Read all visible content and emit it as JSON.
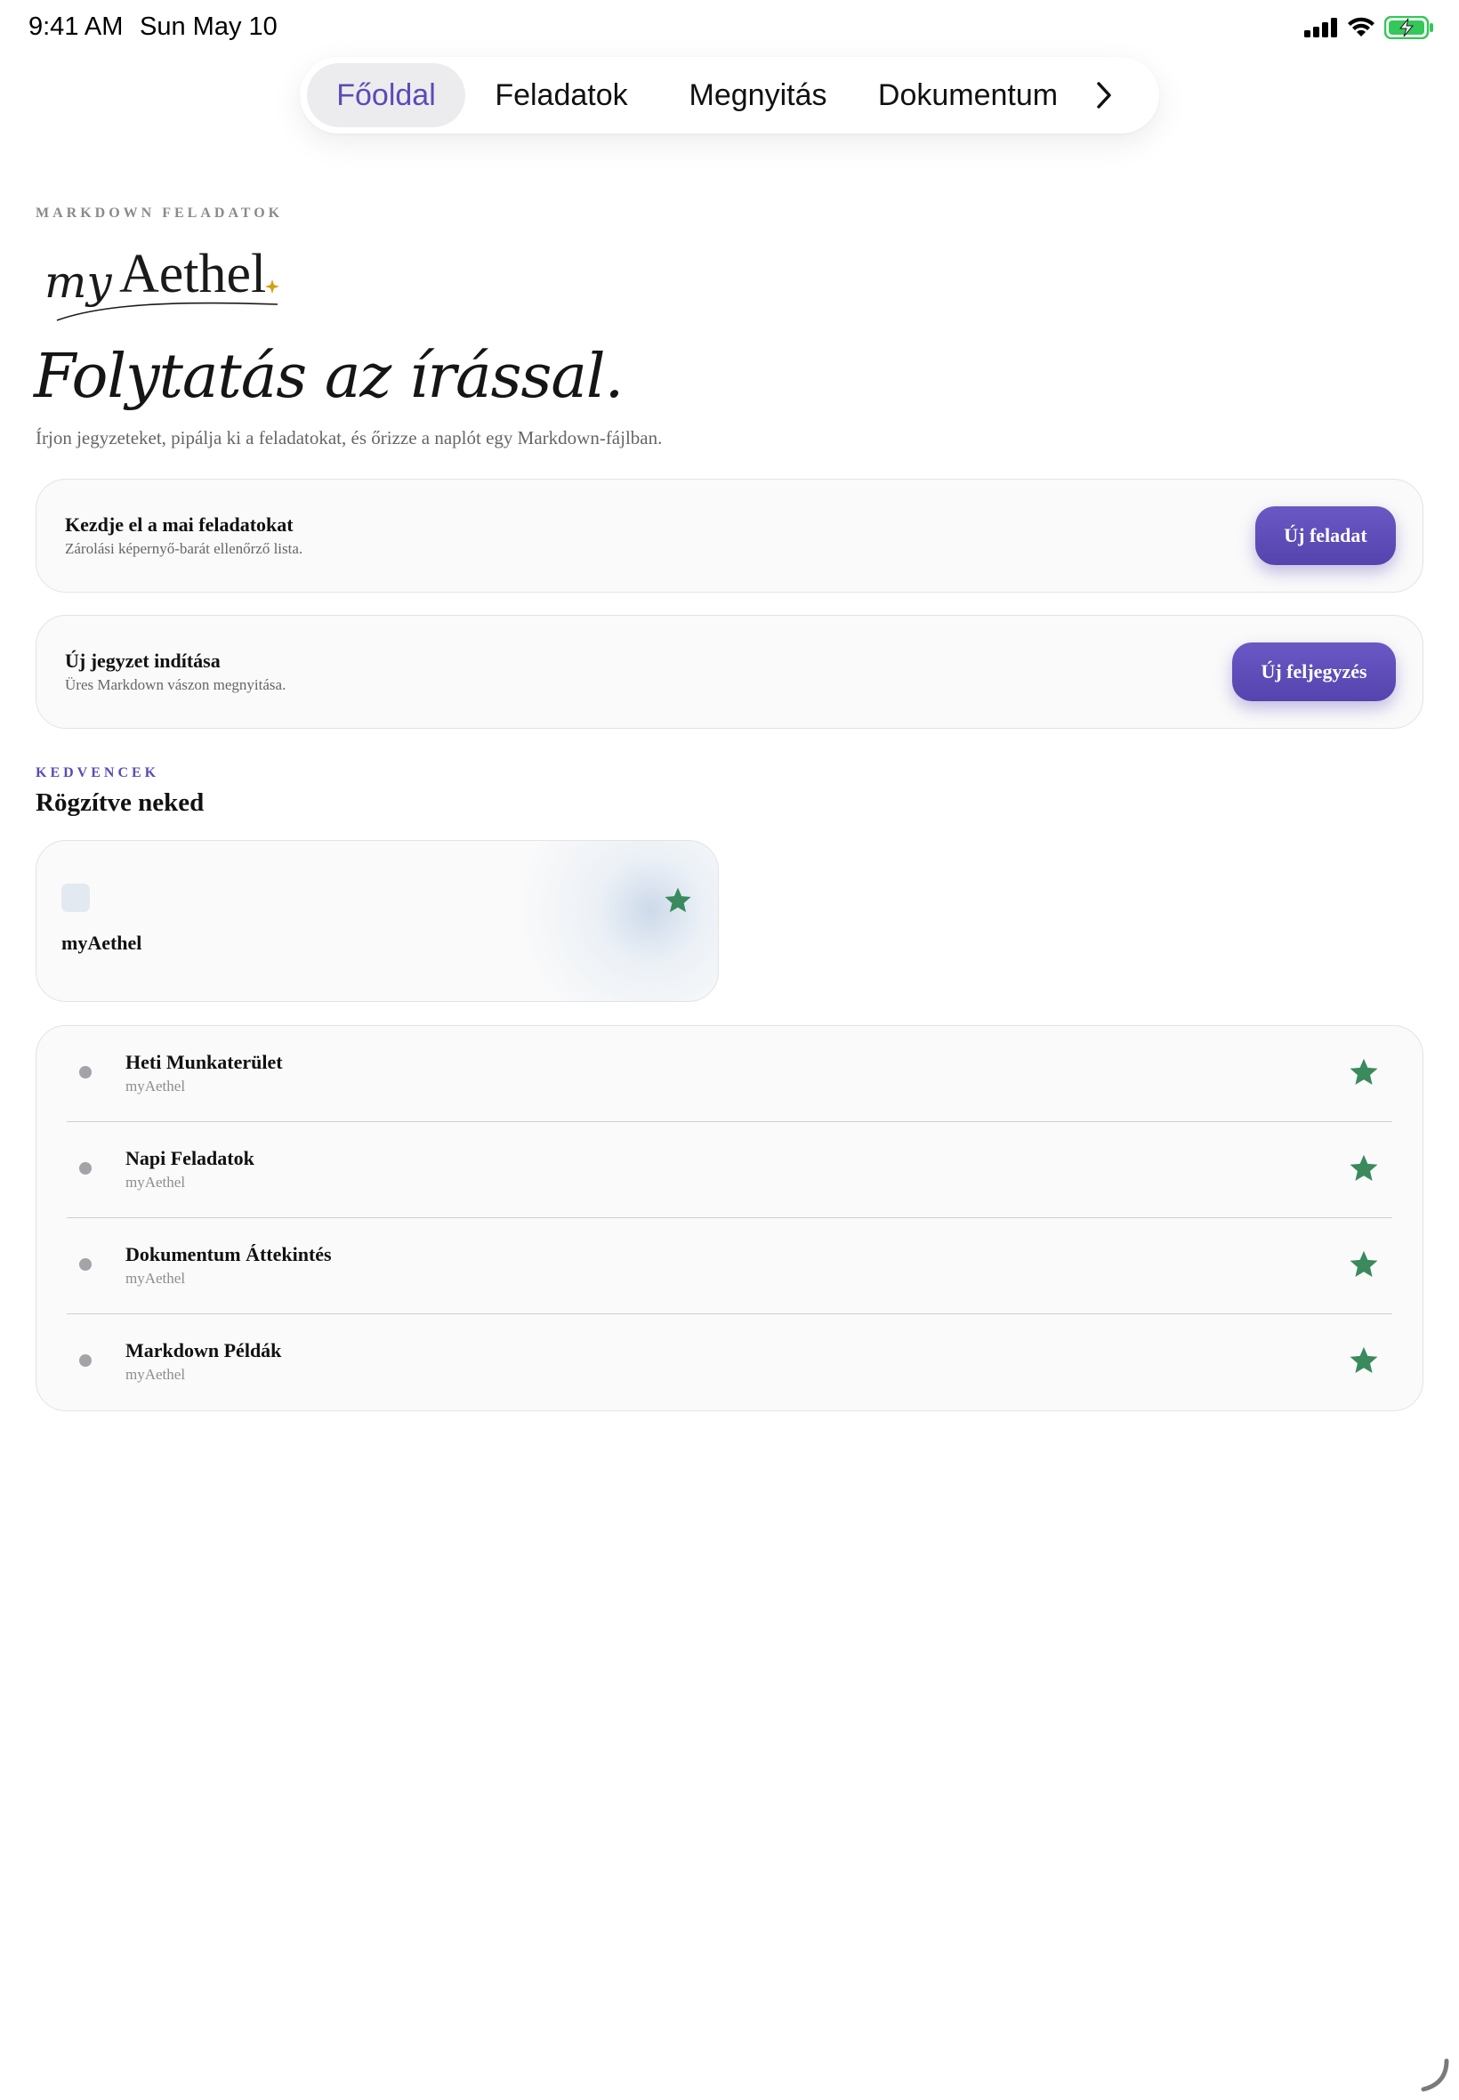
{
  "status_bar": {
    "time": "9:41 AM",
    "date": "Sun May 10"
  },
  "nav": {
    "tabs": [
      {
        "label": "Főoldal",
        "active": true
      },
      {
        "label": "Feladatok",
        "active": false
      },
      {
        "label": "Megnyitás",
        "active": false
      },
      {
        "label": "Dokumentum",
        "active": false
      }
    ],
    "more_icon": "chevron-right-icon"
  },
  "header": {
    "eyebrow": "MARKDOWN FELADATOK",
    "logo_text": "myAethel",
    "title": "Folytatás az írással.",
    "subtitle": "Írjon jegyzeteket, pipálja ki a feladatokat, és őrizze a naplót egy Markdown-fájlban."
  },
  "actions": [
    {
      "title": "Kezdje el a mai feladatokat",
      "subtitle": "Zárolási képernyő-barát ellenőrző lista.",
      "button": "Új feladat"
    },
    {
      "title": "Új jegyzet indítása",
      "subtitle": "Üres Markdown vászon megnyitása.",
      "button": "Új feljegyzés"
    }
  ],
  "favorites": {
    "eyebrow": "KEDVENCEK",
    "title": "Rögzítve neked",
    "card": {
      "label": "myAethel",
      "starred": true
    },
    "list": [
      {
        "title": "Heti Munkaterület",
        "subtitle": "myAethel",
        "starred": true
      },
      {
        "title": "Napi Feladatok",
        "subtitle": "myAethel",
        "starred": true
      },
      {
        "title": "Dokumentum Áttekintés",
        "subtitle": "myAethel",
        "starred": true
      },
      {
        "title": "Markdown Példák",
        "subtitle": "myAethel",
        "starred": true
      }
    ]
  },
  "colors": {
    "accent": "#5b4bb7",
    "star": "#3a8a5e",
    "battery": "#34c759",
    "logo_sparkle": "#d4a017"
  }
}
